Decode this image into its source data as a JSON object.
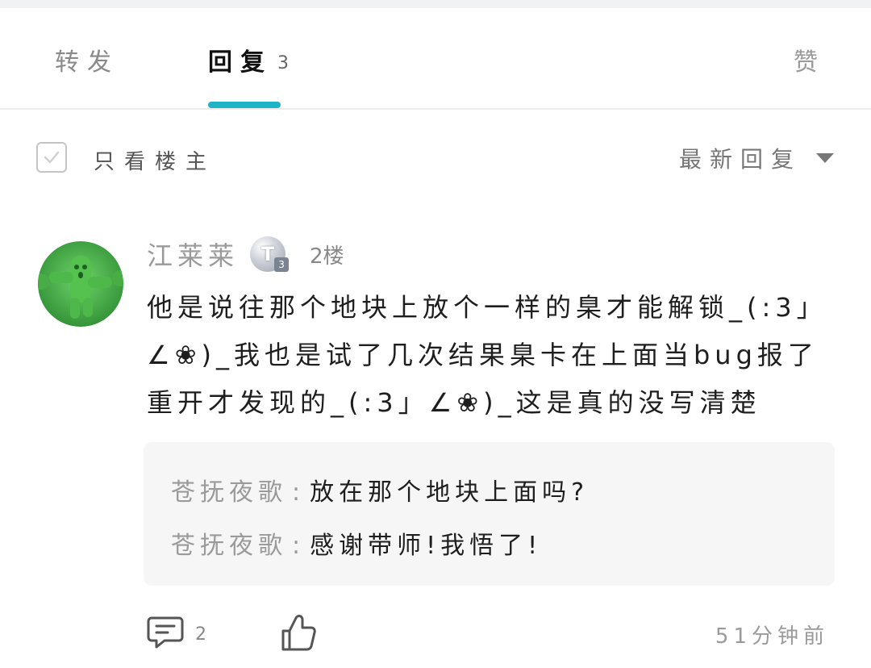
{
  "tabs": {
    "forward": "转发",
    "reply": "回复",
    "reply_count": "3",
    "like": "赞"
  },
  "filter": {
    "only_op_label": "只看楼主",
    "sort_label": "最新回复"
  },
  "post": {
    "username": "江莱莱",
    "level_badge": "T",
    "level_number": "3",
    "floor": "2楼",
    "content": "他是说往那个地块上放个一样的臬才能解锁_(:3」∠❀)_我也是试了几次结果臬卡在上面当bug报了重开才发现的_(:3」∠❀)_这是真的没写清楚",
    "sub_replies": [
      {
        "name": "苍抚夜歌",
        "colon": ":",
        "text": "放在那个地块上面吗?"
      },
      {
        "name": "苍抚夜歌",
        "colon": ":",
        "text": "感谢带师!我悟了!"
      }
    ],
    "comment_count": "2",
    "time": "51分钟前"
  },
  "colors": {
    "accent": "#1fb3c7",
    "avatar_green": "#4caf50"
  },
  "icons": [
    "checkbox-icon",
    "caret-down-icon",
    "comment-icon",
    "thumbs-up-icon",
    "level-badge-icon"
  ]
}
